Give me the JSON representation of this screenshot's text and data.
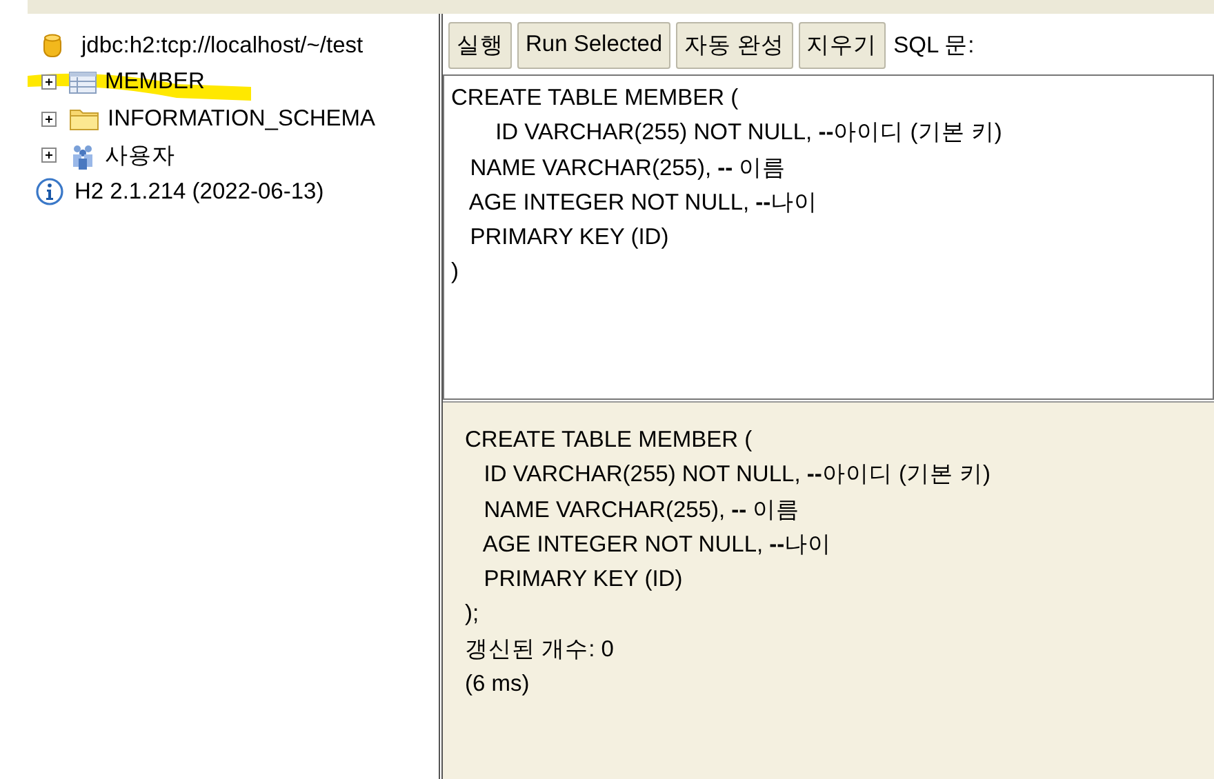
{
  "tree": {
    "connection": "jdbc:h2:tcp://localhost/~/test",
    "items": [
      {
        "kind": "table",
        "label": "MEMBER",
        "expanded": false,
        "highlighted": true
      },
      {
        "kind": "folder",
        "label": "INFORMATION_SCHEMA",
        "expanded": false,
        "highlighted": false
      },
      {
        "kind": "users",
        "label": "사용자",
        "expanded": false,
        "highlighted": false
      }
    ],
    "version": "H2 2.1.214 (2022-06-13)"
  },
  "toolbar": {
    "buttons": [
      "실행",
      "Run Selected",
      "자동 완성",
      "지우기"
    ],
    "label": "SQL 문:"
  },
  "editor": {
    "lines": [
      "CREATE TABLE MEMBER (",
      "       ID VARCHAR(255) NOT NULL, **--**아이디 (기본 키)",
      "   NAME VARCHAR(255), **--** 이름",
      "   AGE INTEGER NOT NULL, **--**나이",
      "   PRIMARY KEY (ID)",
      ")"
    ]
  },
  "result": {
    "lines": [
      "CREATE TABLE MEMBER (",
      "   ID VARCHAR(255) NOT NULL, **--**아이디 (기본 키)",
      "   NAME VARCHAR(255), **--** 이름",
      "   AGE INTEGER NOT NULL, **--**나이",
      "   PRIMARY KEY (ID)",
      ");",
      "갱신된 개수: 0",
      "(6 ms)"
    ]
  }
}
